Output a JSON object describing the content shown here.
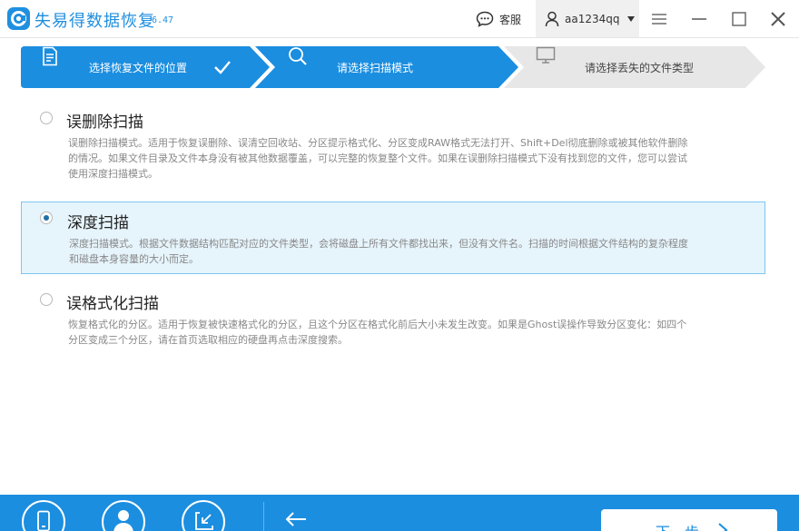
{
  "app": {
    "title": "失易得数据恢复",
    "version": "6.47"
  },
  "header": {
    "support_label": "客服",
    "username": "aa1234qq"
  },
  "steps": [
    {
      "label": "选择恢复文件的位置",
      "status": "done"
    },
    {
      "label": "请选择扫描模式",
      "status": "active"
    },
    {
      "label": "请选择丢失的文件类型",
      "status": "pending"
    }
  ],
  "options": [
    {
      "title": "误删除扫描",
      "desc_lines": [
        "误删除扫描模式。适用于恢复误删除、误清空回收站、分区提示格式化、分区变成RAW格式无法打开、Shift+Del彻底删除或被其他软件删除",
        "的情况。如果文件目录及文件本身没有被其他数据覆盖，可以完整的恢复整个文件。如果在误删除扫描模式下没有找到您的文件，您可以尝试",
        "使用深度扫描模式。"
      ],
      "selected": false
    },
    {
      "title": "深度扫描",
      "desc_lines": [
        "深度扫描模式。根据文件数据结构匹配对应的文件类型，会将磁盘上所有文件都找出来，但没有文件名。扫描的时间根据文件结构的复杂程度",
        "和磁盘本身容量的大小而定。"
      ],
      "selected": true
    },
    {
      "title": "误格式化扫描",
      "desc_lines": [
        "恢复格式化的分区。适用于恢复被快速格式化的分区，且这个分区在格式化前后大小未发生改变。如果是Ghost误操作导致分区变化：如四个",
        "分区变成三个分区，请在首页选取相应的硬盘再点击深度搜索。"
      ],
      "selected": false
    }
  ],
  "footer": {
    "next_label": "下一步"
  },
  "colors": {
    "accent": "#1b8ee0",
    "selected_bg": "#e6f4fc",
    "selected_border": "#7cc6ee",
    "step_pending": "#e7e7e7"
  },
  "icons": [
    "logo-icon",
    "support-chat-icon",
    "user-icon",
    "menu-icon",
    "minimize-icon",
    "maximize-icon",
    "close-icon",
    "document-icon",
    "check-icon",
    "search-icon",
    "monitor-icon",
    "phone-icon",
    "person-icon",
    "export-icon",
    "back-arrow-icon",
    "chevron-right-icon"
  ]
}
